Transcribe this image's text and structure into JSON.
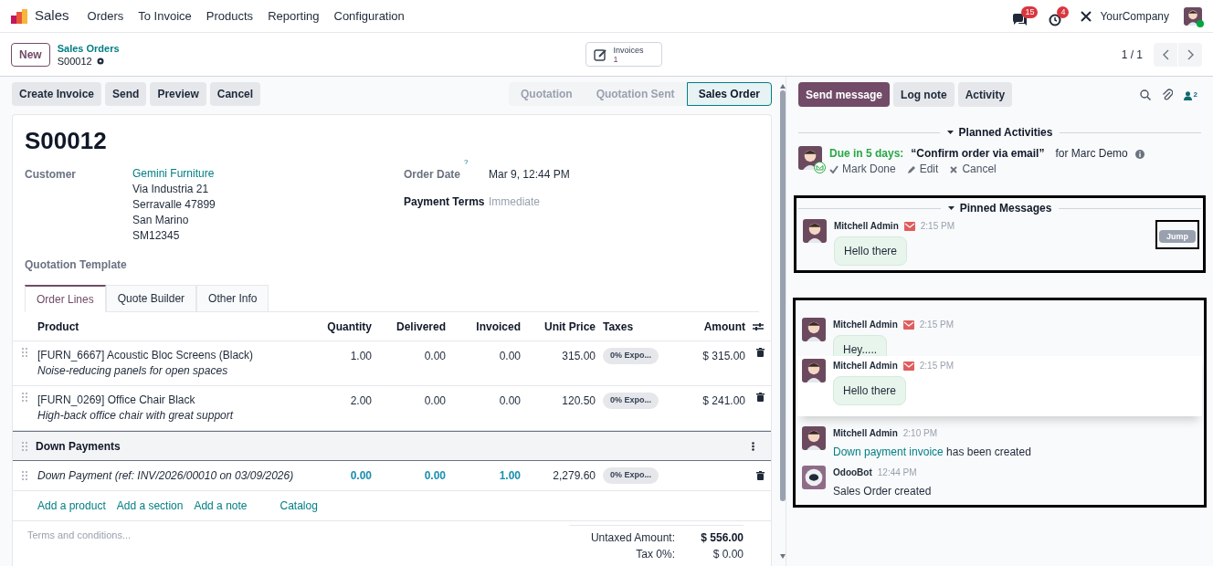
{
  "navbar": {
    "app": "Sales",
    "menus": [
      "Orders",
      "To Invoice",
      "Products",
      "Reporting",
      "Configuration"
    ],
    "messages_badge": "15",
    "activities_badge": "4",
    "company": "YourCompany"
  },
  "breadcrumb": {
    "new_button": "New",
    "parent": "Sales Orders",
    "current": "S00012"
  },
  "smart_button": {
    "label": "Invoices",
    "count": "1"
  },
  "pager": "1 / 1",
  "action_buttons": [
    "Create Invoice",
    "Send",
    "Preview",
    "Cancel"
  ],
  "status_steps": [
    {
      "label": "Quotation",
      "selected": false
    },
    {
      "label": "Quotation Sent",
      "selected": false
    },
    {
      "label": "Sales Order",
      "selected": true
    }
  ],
  "form": {
    "title": "S00012",
    "customer": {
      "label": "Customer",
      "name": "Gemini Furniture",
      "address": [
        "Via Industria 21",
        "Serravalle 47899",
        "San Marino",
        "SM12345"
      ]
    },
    "quotation_template": {
      "label": "Quotation Template"
    },
    "order_date": {
      "label": "Order Date",
      "help": "?",
      "value": "Mar 9, 12:44 PM"
    },
    "payment_terms": {
      "label": "Payment Terms",
      "placeholder": "Immediate"
    },
    "tabs": [
      {
        "label": "Order Lines",
        "selected": true
      },
      {
        "label": "Quote Builder",
        "selected": false
      },
      {
        "label": "Other Info",
        "selected": false
      }
    ],
    "table": {
      "columns": [
        "Product",
        "Quantity",
        "Delivered",
        "Invoiced",
        "Unit Price",
        "Taxes",
        "Amount"
      ],
      "rows": [
        {
          "kind": "line",
          "product": "[FURN_6667] Acoustic Bloc Screens (Black)",
          "description": "Noise-reducing panels for open spaces",
          "quantity": "1.00",
          "delivered": "0.00",
          "invoiced": "0.00",
          "unit_price": "315.00",
          "tax": "0% Expo...",
          "amount": "$ 315.00"
        },
        {
          "kind": "line",
          "product": "[FURN_0269] Office Chair Black",
          "description": "High-back office chair with great support",
          "quantity": "2.00",
          "delivered": "0.00",
          "invoiced": "0.00",
          "unit_price": "120.50",
          "tax": "0% Expo...",
          "amount": "$ 241.00"
        },
        {
          "kind": "section",
          "product": "Down Payments"
        },
        {
          "kind": "down_payment",
          "product": "Down Payment (ref: INV/2026/00010 on 03/09/2026)",
          "quantity": "0.00",
          "delivered": "0.00",
          "invoiced": "1.00",
          "unit_price": "2,279.60",
          "tax": "0% Expo..."
        }
      ]
    },
    "add_links": [
      "Add a product",
      "Add a section",
      "Add a note",
      "Catalog"
    ],
    "terms": {
      "placeholder": "Terms and conditions..."
    },
    "totals": [
      {
        "label": "Untaxed Amount:",
        "value": "$ 556.00",
        "bold": true
      },
      {
        "label": "Tax 0%:",
        "value": "$ 0.00",
        "bold": false
      }
    ]
  },
  "chatter": {
    "buttons": [
      {
        "label": "Send message",
        "selected": true
      },
      {
        "label": "Log note",
        "selected": false
      },
      {
        "label": "Activity",
        "selected": false
      }
    ],
    "followers": "2",
    "planned": {
      "title": "Planned Activities",
      "due": "Due in 5 days:",
      "summary": "“Confirm order via email”",
      "assignee": "for Marc Demo",
      "actions": [
        "Mark Done",
        "Edit",
        "Cancel"
      ]
    },
    "pinned": {
      "title": "Pinned Messages",
      "jump": "Jump",
      "message": {
        "author": "Mitchell Admin",
        "email": true,
        "time": "2:15 PM",
        "body": "Hello there"
      }
    },
    "messages": [
      {
        "kind": "user",
        "author": "Mitchell Admin",
        "email": true,
        "time": "2:15 PM",
        "body": "Hey.....",
        "highlighted": false
      },
      {
        "kind": "user",
        "author": "Mitchell Admin",
        "email": true,
        "time": "2:15 PM",
        "body": "Hello there",
        "highlighted": true
      },
      {
        "kind": "user",
        "author": "Mitchell Admin",
        "email": false,
        "time": "2:10 PM",
        "link": "Down payment invoice",
        "body": "has been created",
        "highlighted": false
      },
      {
        "kind": "bot",
        "author": "OdooBot",
        "email": false,
        "time": "12:44 PM",
        "body": "Sales Order created",
        "highlighted": false
      }
    ]
  }
}
